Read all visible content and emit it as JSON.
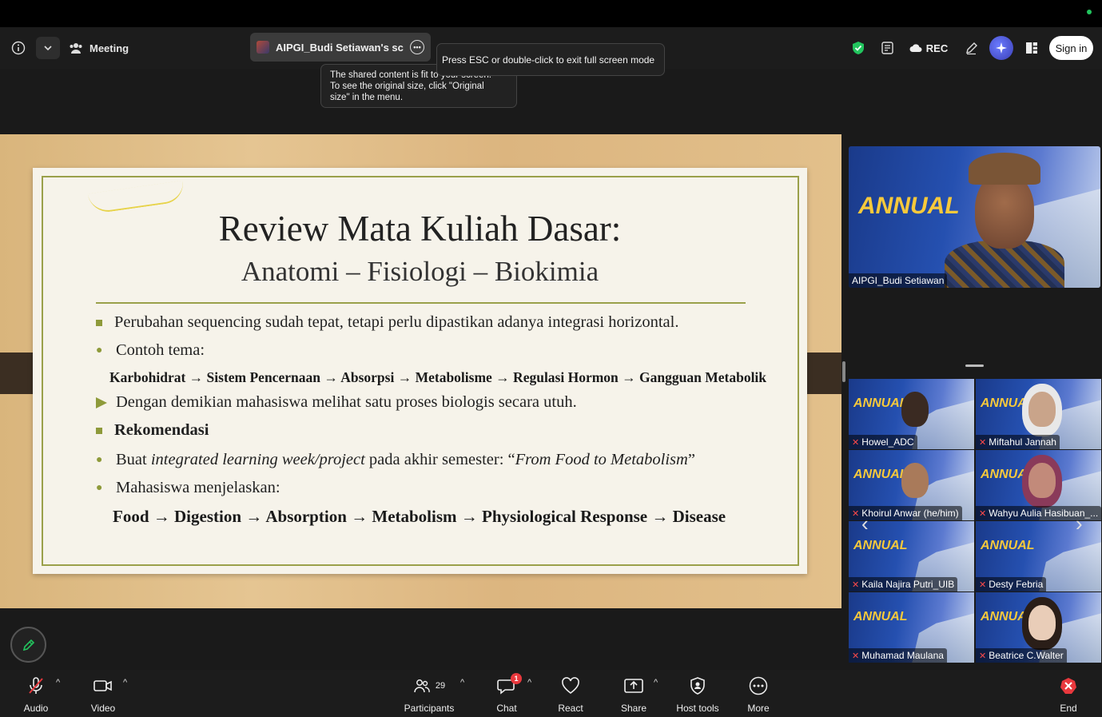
{
  "header": {
    "meeting_label": "Meeting",
    "share_label": "AIPGI_Budi Setiawan's screen",
    "esc_tip": "Press ESC or double-click to exit full screen mode",
    "fit_tip_line1": "The shared content is fit to your screen.",
    "fit_tip_line2": "To see the original size, click \"Original",
    "fit_tip_line3": "size\" in the menu.",
    "rec_label": "REC",
    "signin_label": "Sign in"
  },
  "slide": {
    "title": "Review Mata Kuliah Dasar:",
    "subtitle": "Anatomi – Fisiologi – Biokimia",
    "bullet1": "Perubahan sequencing sudah tepat, tetapi perlu dipastikan adanya integrasi horizontal.",
    "bullet2": "Contoh tema:",
    "flow1": "Karbohidrat → Sistem Pencernaan → Absorpsi → Metabolisme → Regulasi Hormon → Gangguan Metabolik",
    "bullet3": "Dengan demikian mahasiswa melihat satu proses biologis secara utuh.",
    "bullet4": "Rekomendasi",
    "bullet5_pre": "Buat ",
    "bullet5_italic": "integrated learning week/project",
    "bullet5_mid": " pada akhir semester: “",
    "bullet5_italic2": "From Food to Metabolism",
    "bullet5_post": "”",
    "bullet6": "Mahasiswa menjelaskan:",
    "flow2": "Food → Digestion → Absorption → Metabolism → Physiological Response → Disease"
  },
  "speaker": {
    "name": "AIPGI_Budi Setiawan",
    "banner": "ANNUAL"
  },
  "participants": [
    {
      "name": "Howel_ADC"
    },
    {
      "name": "Miftahul Jannah"
    },
    {
      "name": "Khoirul Anwar (he/him)"
    },
    {
      "name": "Wahyu Aulia Hasibuan_..."
    },
    {
      "name": "Kaila Najira Putri_UIB"
    },
    {
      "name": "Desty Febria"
    },
    {
      "name": "Muhamad Maulana"
    },
    {
      "name": "Beatrice C.Walter"
    }
  ],
  "toolbar": {
    "audio": "Audio",
    "video": "Video",
    "participants": "Participants",
    "participants_count": "29",
    "chat": "Chat",
    "chat_badge": "1",
    "react": "React",
    "share": "Share",
    "host_tools": "Host tools",
    "more": "More",
    "end": "End"
  },
  "colors": {
    "accent_green": "#22c55e",
    "end_red": "#e8383d",
    "slide_olive": "#9aa04a"
  }
}
